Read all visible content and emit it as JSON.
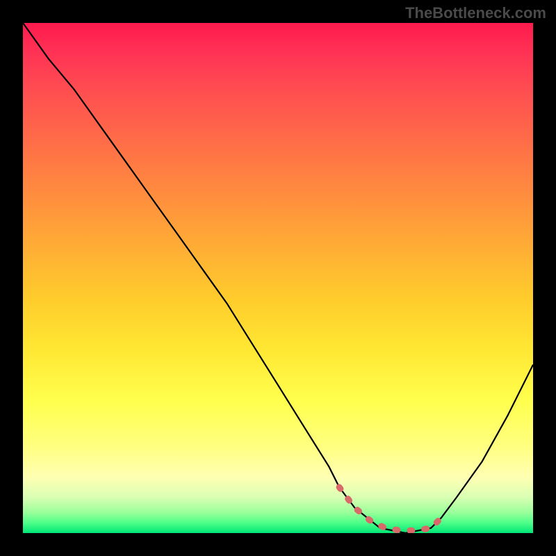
{
  "watermark": "TheBottleneck.com",
  "chart_data": {
    "type": "line",
    "title": "",
    "xlabel": "",
    "ylabel": "",
    "xlim": [
      0,
      100
    ],
    "ylim": [
      0,
      100
    ],
    "background_gradient": {
      "direction": "vertical",
      "stops": [
        {
          "pos": 0,
          "color": "#ff1a4d"
        },
        {
          "pos": 50,
          "color": "#ffcc2c"
        },
        {
          "pos": 85,
          "color": "#ffff99"
        },
        {
          "pos": 100,
          "color": "#00e676"
        }
      ]
    },
    "series": [
      {
        "name": "bottleneck-curve",
        "x": [
          0,
          5,
          10,
          15,
          20,
          25,
          30,
          35,
          40,
          45,
          50,
          55,
          60,
          62,
          65,
          70,
          75,
          80,
          82,
          85,
          90,
          95,
          100
        ],
        "values": [
          100,
          93,
          87,
          80,
          73,
          66,
          59,
          52,
          45,
          37,
          29,
          21,
          13,
          9,
          5,
          1,
          0,
          1,
          3,
          7,
          14,
          23,
          33
        ]
      }
    ],
    "highlight_region": {
      "name": "optimal-zone",
      "x": [
        62,
        65,
        68,
        71,
        74,
        77,
        80,
        82
      ],
      "values": [
        9,
        5,
        2.5,
        1,
        0.5,
        0.5,
        1,
        3
      ],
      "style": "dotted",
      "color": "#d96a6a"
    },
    "colors": {
      "curve": "#000000",
      "highlight": "#d96a6a",
      "frame": "#000000"
    }
  }
}
